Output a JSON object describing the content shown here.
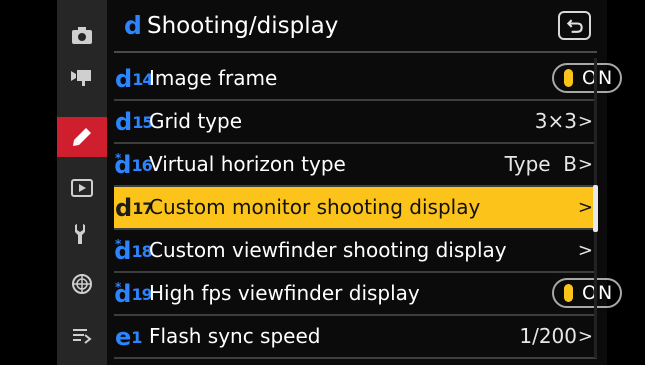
{
  "sidebar": {
    "items": [
      {
        "icon": "camera-icon",
        "active": false
      },
      {
        "icon": "movie-camera-icon",
        "active": false
      },
      {
        "icon": "pencil-icon",
        "active": true
      },
      {
        "icon": "playback-icon",
        "active": false
      },
      {
        "icon": "wrench-icon",
        "active": false
      },
      {
        "icon": "network-icon",
        "active": false
      },
      {
        "icon": "my-menu-icon",
        "active": false
      }
    ]
  },
  "header": {
    "letter": "d",
    "title": "Shooting/display",
    "back_icon": "return-icon"
  },
  "rows": [
    {
      "code_letter": "d",
      "code_num": "14",
      "star": false,
      "label": "Image frame",
      "value": "",
      "toggle": "ON",
      "chevron": false,
      "selected": false
    },
    {
      "code_letter": "d",
      "code_num": "15",
      "star": false,
      "label": "Grid type",
      "value": "3×3",
      "toggle": "",
      "chevron": true,
      "selected": false
    },
    {
      "code_letter": "d",
      "code_num": "16",
      "star": true,
      "label": "Virtual horizon type",
      "value": "Type  B",
      "toggle": "",
      "chevron": true,
      "selected": false
    },
    {
      "code_letter": "d",
      "code_num": "17",
      "star": false,
      "label": "Custom monitor shooting display",
      "value": "",
      "toggle": "",
      "chevron": true,
      "selected": true
    },
    {
      "code_letter": "d",
      "code_num": "18",
      "star": true,
      "label": "Custom viewfinder shooting display",
      "value": "",
      "toggle": "",
      "chevron": true,
      "selected": false
    },
    {
      "code_letter": "d",
      "code_num": "19",
      "star": true,
      "label": "High fps viewfinder display",
      "value": "",
      "toggle": "ON",
      "chevron": false,
      "selected": false
    },
    {
      "code_letter": "e",
      "code_num": "1",
      "star": false,
      "label": "Flash sync speed",
      "value": "1/200",
      "toggle": "",
      "chevron": true,
      "selected": false
    }
  ],
  "colors": {
    "accent_blue": "#2c84ff",
    "selection_yellow": "#fcc31a",
    "active_red": "#cf1f2e"
  }
}
